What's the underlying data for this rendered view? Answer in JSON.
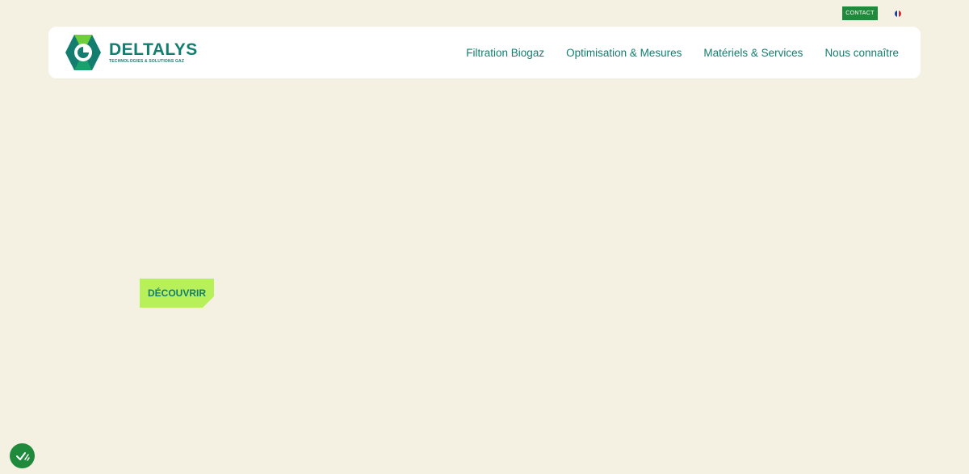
{
  "topbar": {
    "contact_label": "CONTACT",
    "language_flag_colors": [
      "#1d3d9c",
      "#ffffff",
      "#e0262b"
    ]
  },
  "header": {
    "logo": {
      "name": "DELTALYS",
      "tagline": "TECHNOLOGIES & SOLUTIONS GAZ"
    },
    "nav": [
      {
        "label": "Filtration Biogaz"
      },
      {
        "label": "Optimisation & Mesures"
      },
      {
        "label": "Matériels & Services"
      },
      {
        "label": "Nous connaître"
      }
    ]
  },
  "hero": {
    "cta_label": "DÉCOUVRIR"
  },
  "cookie": {
    "icon": "checkmark-icon"
  },
  "colors": {
    "background": "#f5f1e2",
    "brand_teal": "#137d6f",
    "brand_green": "#1f8a3b",
    "accent_lime": "#b8f05a"
  }
}
